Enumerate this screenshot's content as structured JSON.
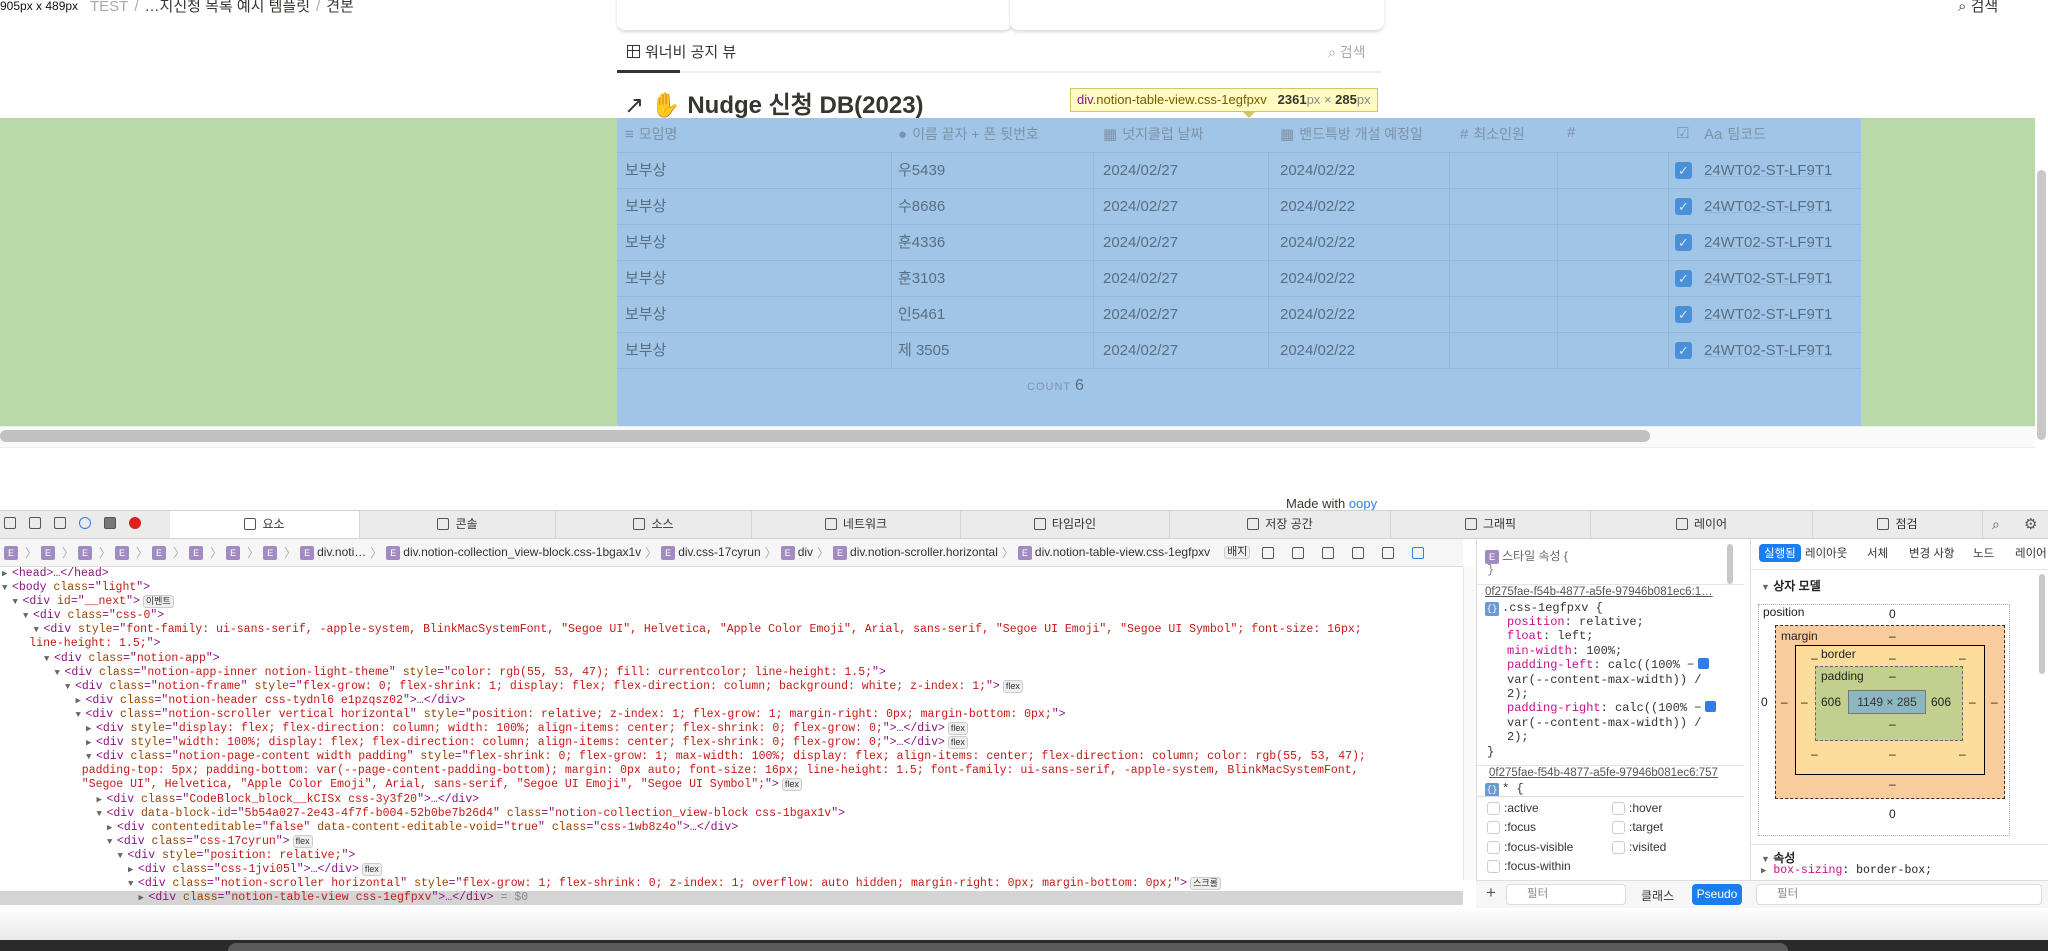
{
  "overlay_size": "905px x 489px",
  "breadcrumb": {
    "items": [
      "TEST",
      "…지신청 목록 예시 템플릿",
      "견본"
    ]
  },
  "top_search": "검색",
  "view_tab": {
    "label": "워너비 공지 뷰",
    "icon": "table-icon",
    "search": "검색"
  },
  "page_title": {
    "arrow": "↗",
    "emoji": "✋",
    "text": "Nudge 신청 DB(2023)"
  },
  "inspector_tooltip": {
    "selector_tag": "div",
    "selector_class": ".notion-table-view.css-1egfpxv",
    "width": "2361",
    "height": "285",
    "unit": "px",
    "times": "×"
  },
  "highlight_colors": {
    "content": "#a0c5e7",
    "padding": "#b9d9a9"
  },
  "table": {
    "headers": [
      {
        "icon": "text-icon",
        "label": "모임명"
      },
      {
        "icon": "person-icon",
        "label": "이름 끝자 + 폰 뒷번호"
      },
      {
        "icon": "calendar-icon",
        "label": "넛지클럽 날짜"
      },
      {
        "icon": "calendar-icon",
        "label": "밴드특방 개설 예정일"
      },
      {
        "icon": "number-icon",
        "label": "최소인원",
        "glyph": "#"
      },
      {
        "icon": "number-icon",
        "label": "",
        "glyph": "#"
      },
      {
        "icon": "checkbox-icon",
        "label": ""
      },
      {
        "icon": "title-icon",
        "label": "팀코드",
        "glyph": "Aa"
      }
    ],
    "rows": [
      {
        "group": "보부상",
        "name": "우5439",
        "nudge_date": "2024/02/27",
        "band_date": "2024/02/22",
        "min": "",
        "num": "",
        "checked": true,
        "code": "24WT02-ST-LF9T1"
      },
      {
        "group": "보부상",
        "name": "수8686",
        "nudge_date": "2024/02/27",
        "band_date": "2024/02/22",
        "min": "",
        "num": "",
        "checked": true,
        "code": "24WT02-ST-LF9T1"
      },
      {
        "group": "보부상",
        "name": "훈4336",
        "nudge_date": "2024/02/27",
        "band_date": "2024/02/22",
        "min": "",
        "num": "",
        "checked": true,
        "code": "24WT02-ST-LF9T1"
      },
      {
        "group": "보부상",
        "name": "훈3103",
        "nudge_date": "2024/02/27",
        "band_date": "2024/02/22",
        "min": "",
        "num": "",
        "checked": true,
        "code": "24WT02-ST-LF9T1"
      },
      {
        "group": "보부상",
        "name": "인5461",
        "nudge_date": "2024/02/27",
        "band_date": "2024/02/22",
        "min": "",
        "num": "",
        "checked": true,
        "code": "24WT02-ST-LF9T1"
      },
      {
        "group": "보부상",
        "name": "제 3505",
        "nudge_date": "2024/02/27",
        "band_date": "2024/02/22",
        "min": "",
        "num": "",
        "checked": true,
        "code": "24WT02-ST-LF9T1"
      }
    ],
    "count_label": "COUNT",
    "count_value": "6"
  },
  "footer": {
    "made_with": "Made with",
    "brand": "oopy"
  },
  "devtools": {
    "tabs": [
      "요소",
      "콘솔",
      "소스",
      "네트워크",
      "타임라인",
      "저장 공간",
      "그래픽",
      "레이어",
      "점검"
    ],
    "active_tab": "요소",
    "breadcrumb": [
      "div.noti…",
      "div.notion-collection_view-block.css-1bgax1v",
      "div.css-17cyrun",
      "div",
      "div.notion-scroller.horizontal",
      "div.notion-table-view.css-1egfpxv"
    ],
    "breadcrumb_badge": "배지",
    "dom_lines": [
      {
        "i": 0,
        "arr": "▶",
        "s": [
          [
            "t",
            "<head>…</head>"
          ]
        ]
      },
      {
        "i": 0,
        "arr": "▼",
        "s": [
          [
            "t",
            "<body "
          ],
          [
            "a",
            "class"
          ],
          [
            "t",
            "=\""
          ],
          [
            "v",
            "light"
          ],
          [
            "t",
            "\">"
          ]
        ]
      },
      {
        "i": 1,
        "arr": "▼",
        "s": [
          [
            "t",
            "<div "
          ],
          [
            "a",
            "id"
          ],
          [
            "t",
            "=\""
          ],
          [
            "v",
            "__next"
          ],
          [
            "t",
            "\">"
          ]
        ],
        "badge": "이벤트"
      },
      {
        "i": 2,
        "arr": "▼",
        "s": [
          [
            "t",
            "<div "
          ],
          [
            "a",
            "class"
          ],
          [
            "t",
            "=\""
          ],
          [
            "v",
            "css-0"
          ],
          [
            "t",
            "\">"
          ]
        ]
      },
      {
        "i": 3,
        "arr": "▼",
        "s": [
          [
            "t",
            "<div "
          ],
          [
            "a",
            "style"
          ],
          [
            "t",
            "=\""
          ],
          [
            "v",
            "font-family: ui-sans-serif, -apple-system, BlinkMacSystemFont, \"Segoe UI\", Helvetica, \"Apple Color Emoji\", Arial, sans-serif, \"Segoe UI Emoji\", \"Segoe UI Symbol\"; font-size: 16px;"
          ]
        ]
      },
      {
        "i": 2.6,
        "arr": "",
        "s": [
          [
            "v",
            "line-height: 1.5;"
          ],
          [
            "t",
            "\">"
          ]
        ]
      },
      {
        "i": 4,
        "arr": "▼",
        "s": [
          [
            "t",
            "<div "
          ],
          [
            "a",
            "class"
          ],
          [
            "t",
            "=\""
          ],
          [
            "v",
            "notion-app"
          ],
          [
            "t",
            "\">"
          ]
        ]
      },
      {
        "i": 5,
        "arr": "▼",
        "s": [
          [
            "t",
            "<div "
          ],
          [
            "a",
            "class"
          ],
          [
            "t",
            "=\""
          ],
          [
            "v",
            "notion-app-inner notion-light-theme"
          ],
          [
            "t",
            "\" "
          ],
          [
            "a",
            "style"
          ],
          [
            "t",
            "=\""
          ],
          [
            "v",
            "color: rgb(55, 53, 47); fill: currentcolor; line-height: 1.5;"
          ],
          [
            "t",
            "\">"
          ]
        ]
      },
      {
        "i": 6,
        "arr": "▼",
        "s": [
          [
            "t",
            "<div "
          ],
          [
            "a",
            "class"
          ],
          [
            "t",
            "=\""
          ],
          [
            "v",
            "notion-frame"
          ],
          [
            "t",
            "\" "
          ],
          [
            "a",
            "style"
          ],
          [
            "t",
            "=\""
          ],
          [
            "v",
            "flex-grow: 0; flex-shrink: 1; display: flex; flex-direction: column; background: white; z-index: 1;"
          ],
          [
            "t",
            "\">"
          ]
        ],
        "badge": "flex"
      },
      {
        "i": 7,
        "arr": "▶",
        "s": [
          [
            "t",
            "<div "
          ],
          [
            "a",
            "class"
          ],
          [
            "t",
            "=\""
          ],
          [
            "v",
            "notion-header css-tydnl6 e1pzqsz02"
          ],
          [
            "t",
            "\">…</div>"
          ]
        ]
      },
      {
        "i": 7,
        "arr": "▼",
        "s": [
          [
            "t",
            "<div "
          ],
          [
            "a",
            "class"
          ],
          [
            "t",
            "=\""
          ],
          [
            "v",
            "notion-scroller vertical horizontal"
          ],
          [
            "t",
            "\" "
          ],
          [
            "a",
            "style"
          ],
          [
            "t",
            "=\""
          ],
          [
            "v",
            "position: relative; z-index: 1; flex-grow: 1; margin-right: 0px; margin-bottom: 0px;"
          ],
          [
            "t",
            "\">"
          ]
        ]
      },
      {
        "i": 8,
        "arr": "▶",
        "s": [
          [
            "t",
            "<div "
          ],
          [
            "a",
            "style"
          ],
          [
            "t",
            "=\""
          ],
          [
            "v",
            "display: flex; flex-direction: column; width: 100%; align-items: center; flex-shrink: 0; flex-grow: 0;"
          ],
          [
            "t",
            "\">…</div>"
          ]
        ],
        "badge": "flex"
      },
      {
        "i": 8,
        "arr": "▶",
        "s": [
          [
            "t",
            "<div "
          ],
          [
            "a",
            "style"
          ],
          [
            "t",
            "=\""
          ],
          [
            "v",
            "width: 100%; display: flex; flex-direction: column; align-items: center; flex-shrink: 0; flex-grow: 0;"
          ],
          [
            "t",
            "\">…</div>"
          ]
        ],
        "badge": "flex"
      },
      {
        "i": 8,
        "arr": "▼",
        "s": [
          [
            "t",
            "<div "
          ],
          [
            "a",
            "class"
          ],
          [
            "t",
            "=\""
          ],
          [
            "v",
            "notion-page-content width padding"
          ],
          [
            "t",
            "\" "
          ],
          [
            "a",
            "style"
          ],
          [
            "t",
            "=\""
          ],
          [
            "v",
            "flex-shrink: 0; flex-grow: 1; max-width: 100%; display: flex; align-items: center; flex-direction: column; color: rgb(55, 53, 47);"
          ]
        ]
      },
      {
        "i": 7.6,
        "arr": "",
        "s": [
          [
            "v",
            "padding-top: 5px; padding-bottom: var(--page-content-padding-bottom); margin: 0px auto; font-size: 16px; line-height: 1.5; font-family: ui-sans-serif, -apple-system, BlinkMacSystemFont,"
          ]
        ]
      },
      {
        "i": 7.6,
        "arr": "",
        "s": [
          [
            "v",
            "\"Segoe UI\", Helvetica, \"Apple Color Emoji\", Arial, sans-serif, \"Segoe UI Emoji\", \"Segoe UI Symbol\";"
          ],
          [
            "t",
            "\">"
          ]
        ],
        "badge": "flex"
      },
      {
        "i": 9,
        "arr": "▶",
        "s": [
          [
            "t",
            "<div "
          ],
          [
            "a",
            "class"
          ],
          [
            "t",
            "=\""
          ],
          [
            "v",
            "CodeBlock_block__kCISx css-3y3f20"
          ],
          [
            "t",
            "\">…</div>"
          ]
        ]
      },
      {
        "i": 9,
        "arr": "▼",
        "s": [
          [
            "t",
            "<div "
          ],
          [
            "a",
            "data-block-id"
          ],
          [
            "t",
            "=\""
          ],
          [
            "v",
            "5b54a027-2e43-4f7f-b004-52b0be7b26d4"
          ],
          [
            "t",
            "\" "
          ],
          [
            "a",
            "class"
          ],
          [
            "t",
            "=\""
          ],
          [
            "v",
            "notion-collection_view-block css-1bgax1v"
          ],
          [
            "t",
            "\">"
          ]
        ]
      },
      {
        "i": 10,
        "arr": "▶",
        "s": [
          [
            "t",
            "<div "
          ],
          [
            "a",
            "contenteditable"
          ],
          [
            "t",
            "=\""
          ],
          [
            "v",
            "false"
          ],
          [
            "t",
            "\" "
          ],
          [
            "a",
            "data-content-editable-void"
          ],
          [
            "t",
            "=\""
          ],
          [
            "v",
            "true"
          ],
          [
            "t",
            "\" "
          ],
          [
            "a",
            "class"
          ],
          [
            "t",
            "=\""
          ],
          [
            "v",
            "css-1wb8z4o"
          ],
          [
            "t",
            "\">…</div>"
          ]
        ]
      },
      {
        "i": 10,
        "arr": "▼",
        "s": [
          [
            "t",
            "<div "
          ],
          [
            "a",
            "class"
          ],
          [
            "t",
            "=\""
          ],
          [
            "v",
            "css-17cyrun"
          ],
          [
            "t",
            "\">"
          ]
        ],
        "badge": "flex"
      },
      {
        "i": 11,
        "arr": "▼",
        "s": [
          [
            "t",
            "<div "
          ],
          [
            "a",
            "style"
          ],
          [
            "t",
            "=\""
          ],
          [
            "v",
            "position: relative;"
          ],
          [
            "t",
            "\">"
          ]
        ]
      },
      {
        "i": 12,
        "arr": "▶",
        "s": [
          [
            "t",
            "<div "
          ],
          [
            "a",
            "class"
          ],
          [
            "t",
            "=\""
          ],
          [
            "v",
            "css-1jvi05l"
          ],
          [
            "t",
            "\">…</div>"
          ]
        ],
        "badge": "flex"
      },
      {
        "i": 12,
        "arr": "▼",
        "s": [
          [
            "t",
            "<div "
          ],
          [
            "a",
            "class"
          ],
          [
            "t",
            "=\""
          ],
          [
            "v",
            "notion-scroller horizontal"
          ],
          [
            "t",
            "\" "
          ],
          [
            "a",
            "style"
          ],
          [
            "t",
            "=\""
          ],
          [
            "v",
            "flex-grow: 1; flex-shrink: 0; z-index: 1; overflow: auto hidden; margin-right: 0px; margin-bottom: 0px;"
          ],
          [
            "t",
            "\">"
          ]
        ],
        "badge": "스크롤"
      },
      {
        "i": 13,
        "arr": "▶",
        "sel": true,
        "s": [
          [
            "t",
            "<div "
          ],
          [
            "a",
            "class"
          ],
          [
            "t",
            "=\""
          ],
          [
            "v",
            "notion-table-view css-1egfpxv"
          ],
          [
            "t",
            "\">…</div>"
          ],
          [
            "x",
            " = $0"
          ]
        ]
      }
    ],
    "styles": {
      "style_attr_label": "스타일 속성 {",
      "style_attr_close": "}",
      "rule1_source": "0f275fae-f54b-4877-a5fe-97946b081ec6:1…",
      "rule1_selector": ".css-1egfpxv {",
      "rule1_lines": [
        [
          "position",
          ": relative;"
        ],
        [
          "float",
          ": left;"
        ],
        [
          "min-width",
          ": 100%;"
        ],
        [
          "padding-left",
          ": calc((100% −"
        ],
        [
          "",
          "var(--content-max-width)) /"
        ],
        [
          "",
          "2);"
        ],
        [
          "padding-right",
          ": calc((100% −"
        ],
        [
          "",
          "var(--content-max-width)) /"
        ],
        [
          "",
          "2);"
        ],
        [
          "",
          "}"
        ]
      ],
      "rule2_source": "0f275fae-f54b-4877-a5fe-97946b081ec6:757",
      "rule2_selector": "* {",
      "pseudo": [
        ":active",
        ":hover",
        ":focus",
        ":target",
        ":focus-visible",
        ":visited",
        ":focus-within"
      ],
      "filter_placeholder": "필터",
      "class_label": "클래스",
      "pseudo_button": "Pseudo"
    },
    "computed": {
      "tabs": [
        "실행됨",
        "레이아웃",
        "서체",
        "변경 사항",
        "노드",
        "레이어"
      ],
      "active_tab": "실행됨",
      "box_model_label": "상자 모델",
      "position_label": "position",
      "position_top": "0",
      "position_left": "0",
      "position_bottom": "0",
      "margin_label": "margin",
      "border_label": "border",
      "padding_label": "padding",
      "dash": "–",
      "padding_left": "606",
      "padding_right": "606",
      "content_size": "1149 × 285",
      "properties_label": "속성",
      "property_name": "box-sizing",
      "property_value": ": border-box;",
      "filter_placeholder": "필터"
    }
  }
}
